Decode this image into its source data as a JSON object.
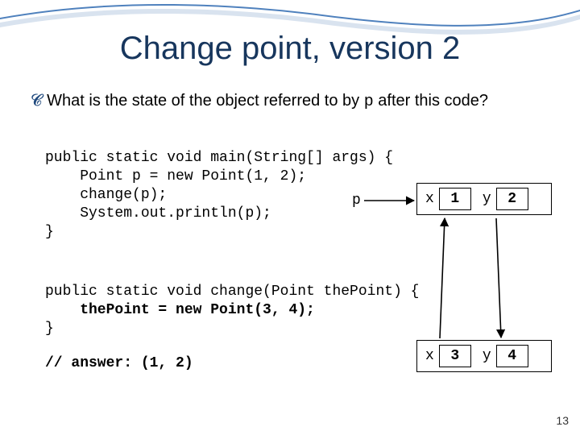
{
  "title": "Change point, version 2",
  "question_pre": "What is the state of the object referred to by ",
  "question_var": "p",
  "question_post": " after this code?",
  "code_main": "public static void main(String[] args) {\n    Point p = new Point(1, 2);\n    change(p);\n    System.out.println(p);\n}",
  "code_change_sig": "public static void change(Point thePoint) {",
  "code_change_body": "    thePoint = new Point(3, 4);",
  "code_change_close": "}",
  "answer": "// answer: (1, 2)",
  "p_label": "p",
  "obj1": {
    "xlabel": "x",
    "xval": "1",
    "ylabel": "y",
    "yval": "2"
  },
  "obj2": {
    "xlabel": "x",
    "xval": "3",
    "ylabel": "y",
    "yval": "4"
  },
  "page_num": "13"
}
